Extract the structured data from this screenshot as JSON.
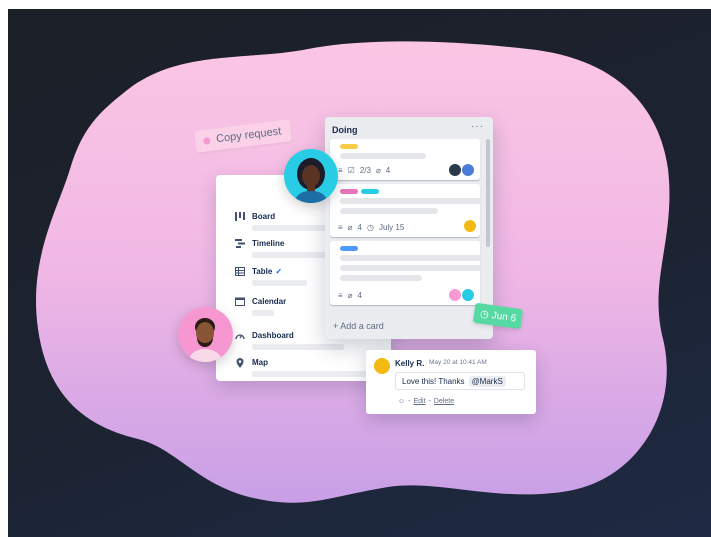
{
  "tag": {
    "label": "Copy request"
  },
  "sidebar": {
    "items": [
      {
        "label": "Board",
        "icon": "board-icon",
        "checked": false
      },
      {
        "label": "Timeline",
        "icon": "timeline-icon",
        "checked": false
      },
      {
        "label": "Table",
        "icon": "table-icon",
        "checked": true
      },
      {
        "label": "Calendar",
        "icon": "calendar-icon",
        "checked": false
      },
      {
        "label": "Dashboard",
        "icon": "dashboard-icon",
        "checked": false
      },
      {
        "label": "Map",
        "icon": "location-pin-icon",
        "checked": false
      }
    ],
    "check_mark": "✓"
  },
  "list": {
    "title": "Doing",
    "menu": "···",
    "cards": [
      {
        "labels": [
          "#f5cd47"
        ],
        "checklist": "2/3",
        "attachments": "4",
        "due": ""
      },
      {
        "labels": [
          "#e774bb",
          "#29cce5"
        ],
        "checklist": "",
        "attachments": "4",
        "due": "July 15"
      },
      {
        "labels": [
          "#4c9aff"
        ],
        "checklist": "",
        "attachments": "4",
        "due": ""
      }
    ],
    "add_card": "Add a card",
    "add_icon": "+"
  },
  "date_badge": {
    "label": "Jun 6",
    "color": "#57d9a3"
  },
  "comment": {
    "author": "Kelly R.",
    "time": "May 20 at 10:41 AM",
    "text": "Love this! Thanks",
    "mention": "@MarkS",
    "edit": "Edit",
    "delete": "Delete",
    "sep": "-"
  },
  "colors": {
    "blob_top": "#fdc5e4",
    "blob_bottom": "#e39bd4",
    "background": "#1c2331"
  }
}
